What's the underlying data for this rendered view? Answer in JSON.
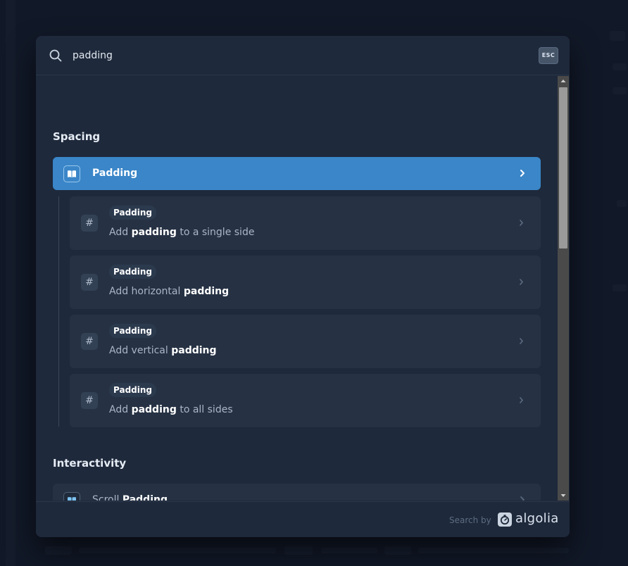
{
  "search": {
    "value": "padding",
    "esc_label": "ESC"
  },
  "sections": [
    {
      "title": "Spacing",
      "page": {
        "title": "Padding",
        "active": true
      },
      "subs": [
        {
          "badge": "Padding",
          "pre": "Add ",
          "bold": "padding",
          "post": " to a single side"
        },
        {
          "badge": "Padding",
          "pre": "Add horizontal ",
          "bold": "padding",
          "post": ""
        },
        {
          "badge": "Padding",
          "pre": "Add vertical ",
          "bold": "padding",
          "post": ""
        },
        {
          "badge": "Padding",
          "pre": "Add ",
          "bold": "padding",
          "post": " to all sides"
        }
      ]
    },
    {
      "title": "Interactivity",
      "page": {
        "pre": "Scroll ",
        "bold": "Padding",
        "active": false
      }
    }
  ],
  "footer": {
    "search_by": "Search by",
    "brand": "algolia"
  },
  "icons": {
    "search": "search-icon",
    "page": "book-icon",
    "hash": "hash-icon",
    "chevron": "chevron-right-icon",
    "brand": "algolia-stopwatch-icon"
  },
  "colors": {
    "modal_bg": "#1e293b",
    "item_bg": "#263244",
    "active": "#3a86c8",
    "text_muted": "#aab6c7"
  }
}
